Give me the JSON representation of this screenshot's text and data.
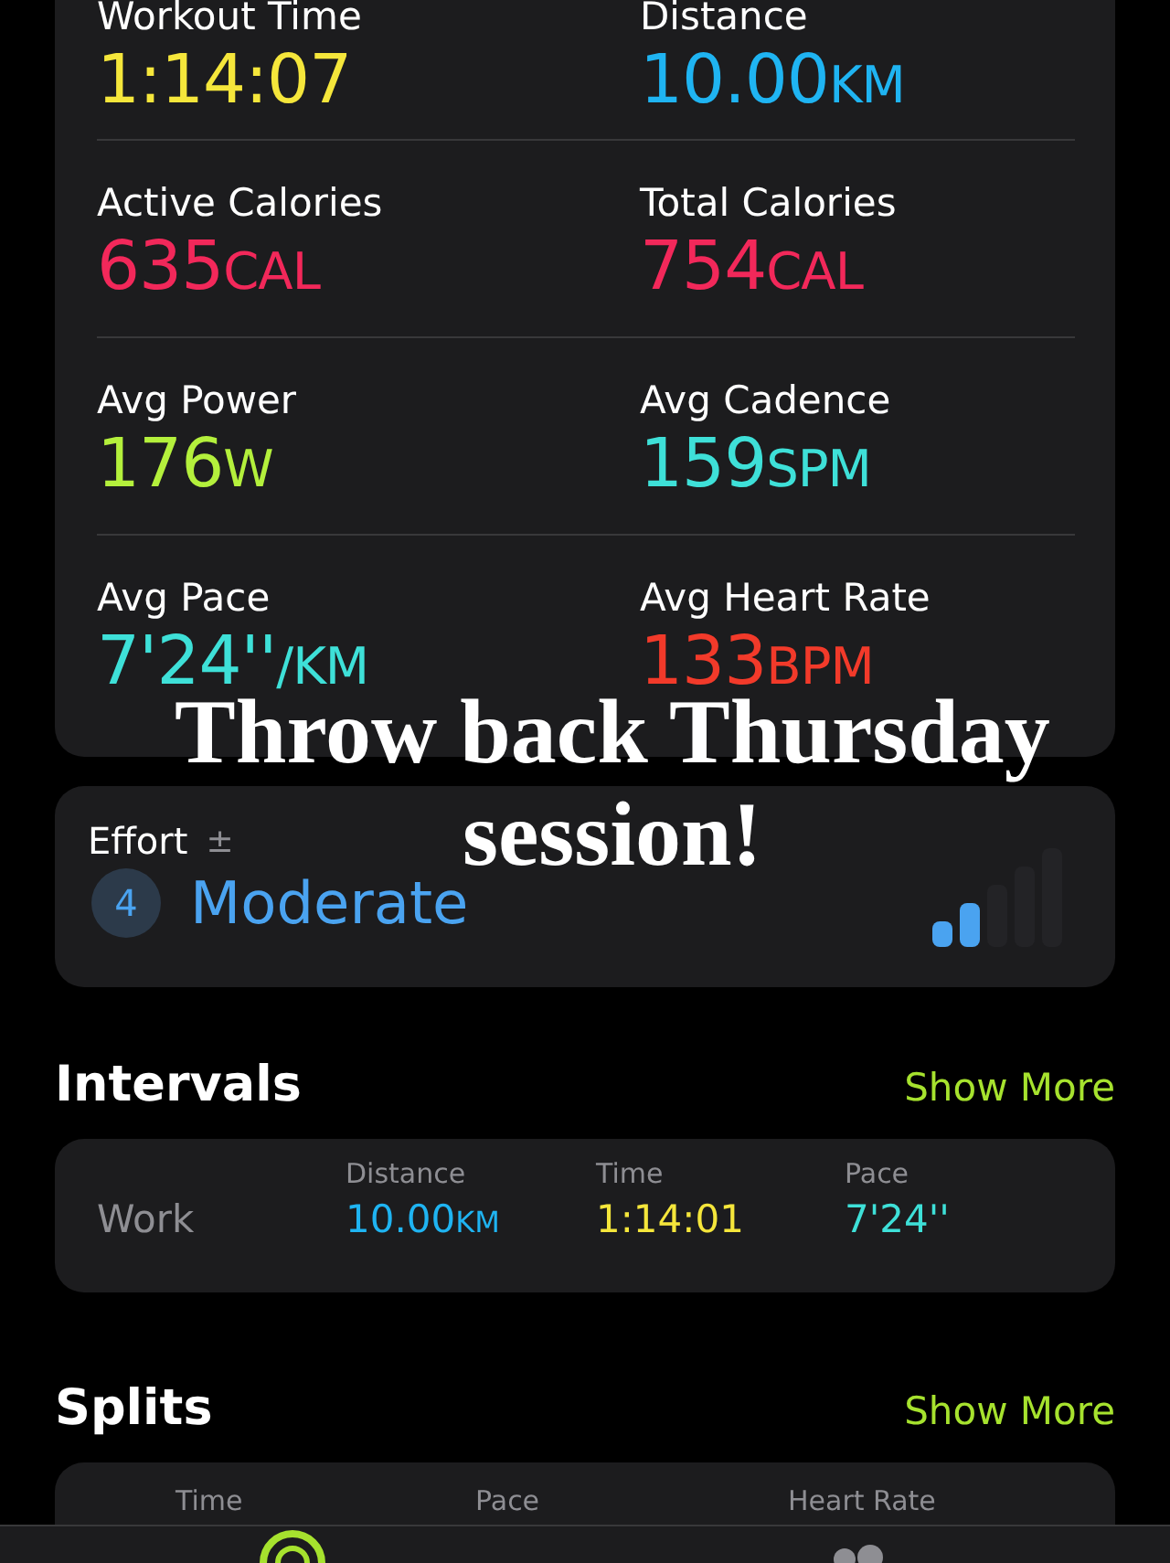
{
  "metrics": [
    {
      "label": "Workout Time",
      "value": "1:14:07",
      "color": "#f5e63b"
    },
    {
      "label": "Distance",
      "value": "10.00",
      "unit": "KM",
      "color": "#1fb4f2"
    },
    {
      "label": "Active Calories",
      "value": "635",
      "unit": "CAL",
      "color": "#f2285a"
    },
    {
      "label": "Total Calories",
      "value": "754",
      "unit": "CAL",
      "color": "#f2285a"
    },
    {
      "label": "Avg Power",
      "value": "176",
      "unit": "W",
      "color": "#b4f03c"
    },
    {
      "label": "Avg Cadence",
      "value": "159",
      "unit": "SPM",
      "color": "#3ee0d8"
    },
    {
      "label": "Avg Pace",
      "value": "7'24''",
      "unit": "/KM",
      "color": "#3ee0d8"
    },
    {
      "label": "Avg Heart Rate",
      "value": "133",
      "unit": "BPM",
      "color": "#f23a2a"
    }
  ],
  "effort": {
    "label": "Effort",
    "adjust": "±",
    "number": "4",
    "rating": "Moderate",
    "level": 0.4
  },
  "intervals": {
    "title": "Intervals",
    "action": "Show More",
    "columns": [
      "Distance",
      "Time",
      "Pace"
    ],
    "rows": [
      {
        "name": "Work",
        "cells": [
          {
            "value": "10.00",
            "unit": "KM",
            "color": "#1fb4f2"
          },
          {
            "value": "1:14:01",
            "color": "#f5e63b"
          },
          {
            "value": "7'24''",
            "color": "#3ee0d8"
          }
        ]
      }
    ]
  },
  "splits": {
    "title": "Splits",
    "action": "Show More",
    "columns": [
      "Time",
      "Pace",
      "Heart Rate"
    ]
  },
  "caption_lines": [
    "Throw back Thursday",
    "session!"
  ]
}
